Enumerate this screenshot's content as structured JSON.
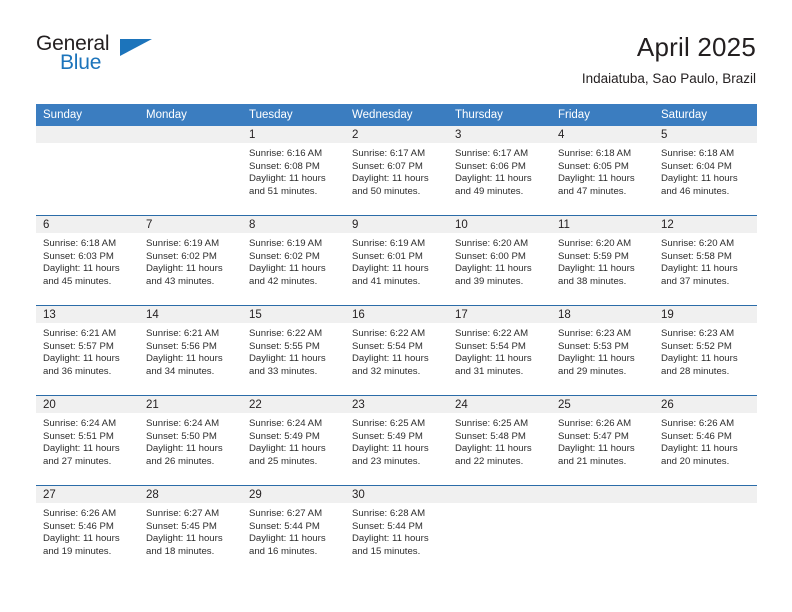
{
  "brand": {
    "name_part1": "General",
    "name_part2": "Blue",
    "triangle_icon": "triangle-icon",
    "accent_color": "#1c74bb"
  },
  "header": {
    "month_title": "April 2025",
    "location": "Indaiatuba, Sao Paulo, Brazil"
  },
  "calendar": {
    "header_bg": "#3b7dc0",
    "daynum_bg": "#f0f0f0",
    "divider_color": "#2b6ca8",
    "weekday_headers": [
      "Sunday",
      "Monday",
      "Tuesday",
      "Wednesday",
      "Thursday",
      "Friday",
      "Saturday"
    ],
    "weeks": [
      [
        {
          "day": "",
          "lines": []
        },
        {
          "day": "",
          "lines": []
        },
        {
          "day": "1",
          "lines": [
            "Sunrise: 6:16 AM",
            "Sunset: 6:08 PM",
            "Daylight: 11 hours",
            "and 51 minutes."
          ]
        },
        {
          "day": "2",
          "lines": [
            "Sunrise: 6:17 AM",
            "Sunset: 6:07 PM",
            "Daylight: 11 hours",
            "and 50 minutes."
          ]
        },
        {
          "day": "3",
          "lines": [
            "Sunrise: 6:17 AM",
            "Sunset: 6:06 PM",
            "Daylight: 11 hours",
            "and 49 minutes."
          ]
        },
        {
          "day": "4",
          "lines": [
            "Sunrise: 6:18 AM",
            "Sunset: 6:05 PM",
            "Daylight: 11 hours",
            "and 47 minutes."
          ]
        },
        {
          "day": "5",
          "lines": [
            "Sunrise: 6:18 AM",
            "Sunset: 6:04 PM",
            "Daylight: 11 hours",
            "and 46 minutes."
          ]
        }
      ],
      [
        {
          "day": "6",
          "lines": [
            "Sunrise: 6:18 AM",
            "Sunset: 6:03 PM",
            "Daylight: 11 hours",
            "and 45 minutes."
          ]
        },
        {
          "day": "7",
          "lines": [
            "Sunrise: 6:19 AM",
            "Sunset: 6:02 PM",
            "Daylight: 11 hours",
            "and 43 minutes."
          ]
        },
        {
          "day": "8",
          "lines": [
            "Sunrise: 6:19 AM",
            "Sunset: 6:02 PM",
            "Daylight: 11 hours",
            "and 42 minutes."
          ]
        },
        {
          "day": "9",
          "lines": [
            "Sunrise: 6:19 AM",
            "Sunset: 6:01 PM",
            "Daylight: 11 hours",
            "and 41 minutes."
          ]
        },
        {
          "day": "10",
          "lines": [
            "Sunrise: 6:20 AM",
            "Sunset: 6:00 PM",
            "Daylight: 11 hours",
            "and 39 minutes."
          ]
        },
        {
          "day": "11",
          "lines": [
            "Sunrise: 6:20 AM",
            "Sunset: 5:59 PM",
            "Daylight: 11 hours",
            "and 38 minutes."
          ]
        },
        {
          "day": "12",
          "lines": [
            "Sunrise: 6:20 AM",
            "Sunset: 5:58 PM",
            "Daylight: 11 hours",
            "and 37 minutes."
          ]
        }
      ],
      [
        {
          "day": "13",
          "lines": [
            "Sunrise: 6:21 AM",
            "Sunset: 5:57 PM",
            "Daylight: 11 hours",
            "and 36 minutes."
          ]
        },
        {
          "day": "14",
          "lines": [
            "Sunrise: 6:21 AM",
            "Sunset: 5:56 PM",
            "Daylight: 11 hours",
            "and 34 minutes."
          ]
        },
        {
          "day": "15",
          "lines": [
            "Sunrise: 6:22 AM",
            "Sunset: 5:55 PM",
            "Daylight: 11 hours",
            "and 33 minutes."
          ]
        },
        {
          "day": "16",
          "lines": [
            "Sunrise: 6:22 AM",
            "Sunset: 5:54 PM",
            "Daylight: 11 hours",
            "and 32 minutes."
          ]
        },
        {
          "day": "17",
          "lines": [
            "Sunrise: 6:22 AM",
            "Sunset: 5:54 PM",
            "Daylight: 11 hours",
            "and 31 minutes."
          ]
        },
        {
          "day": "18",
          "lines": [
            "Sunrise: 6:23 AM",
            "Sunset: 5:53 PM",
            "Daylight: 11 hours",
            "and 29 minutes."
          ]
        },
        {
          "day": "19",
          "lines": [
            "Sunrise: 6:23 AM",
            "Sunset: 5:52 PM",
            "Daylight: 11 hours",
            "and 28 minutes."
          ]
        }
      ],
      [
        {
          "day": "20",
          "lines": [
            "Sunrise: 6:24 AM",
            "Sunset: 5:51 PM",
            "Daylight: 11 hours",
            "and 27 minutes."
          ]
        },
        {
          "day": "21",
          "lines": [
            "Sunrise: 6:24 AM",
            "Sunset: 5:50 PM",
            "Daylight: 11 hours",
            "and 26 minutes."
          ]
        },
        {
          "day": "22",
          "lines": [
            "Sunrise: 6:24 AM",
            "Sunset: 5:49 PM",
            "Daylight: 11 hours",
            "and 25 minutes."
          ]
        },
        {
          "day": "23",
          "lines": [
            "Sunrise: 6:25 AM",
            "Sunset: 5:49 PM",
            "Daylight: 11 hours",
            "and 23 minutes."
          ]
        },
        {
          "day": "24",
          "lines": [
            "Sunrise: 6:25 AM",
            "Sunset: 5:48 PM",
            "Daylight: 11 hours",
            "and 22 minutes."
          ]
        },
        {
          "day": "25",
          "lines": [
            "Sunrise: 6:26 AM",
            "Sunset: 5:47 PM",
            "Daylight: 11 hours",
            "and 21 minutes."
          ]
        },
        {
          "day": "26",
          "lines": [
            "Sunrise: 6:26 AM",
            "Sunset: 5:46 PM",
            "Daylight: 11 hours",
            "and 20 minutes."
          ]
        }
      ],
      [
        {
          "day": "27",
          "lines": [
            "Sunrise: 6:26 AM",
            "Sunset: 5:46 PM",
            "Daylight: 11 hours",
            "and 19 minutes."
          ]
        },
        {
          "day": "28",
          "lines": [
            "Sunrise: 6:27 AM",
            "Sunset: 5:45 PM",
            "Daylight: 11 hours",
            "and 18 minutes."
          ]
        },
        {
          "day": "29",
          "lines": [
            "Sunrise: 6:27 AM",
            "Sunset: 5:44 PM",
            "Daylight: 11 hours",
            "and 16 minutes."
          ]
        },
        {
          "day": "30",
          "lines": [
            "Sunrise: 6:28 AM",
            "Sunset: 5:44 PM",
            "Daylight: 11 hours",
            "and 15 minutes."
          ]
        },
        {
          "day": "",
          "lines": []
        },
        {
          "day": "",
          "lines": []
        },
        {
          "day": "",
          "lines": []
        }
      ]
    ]
  }
}
